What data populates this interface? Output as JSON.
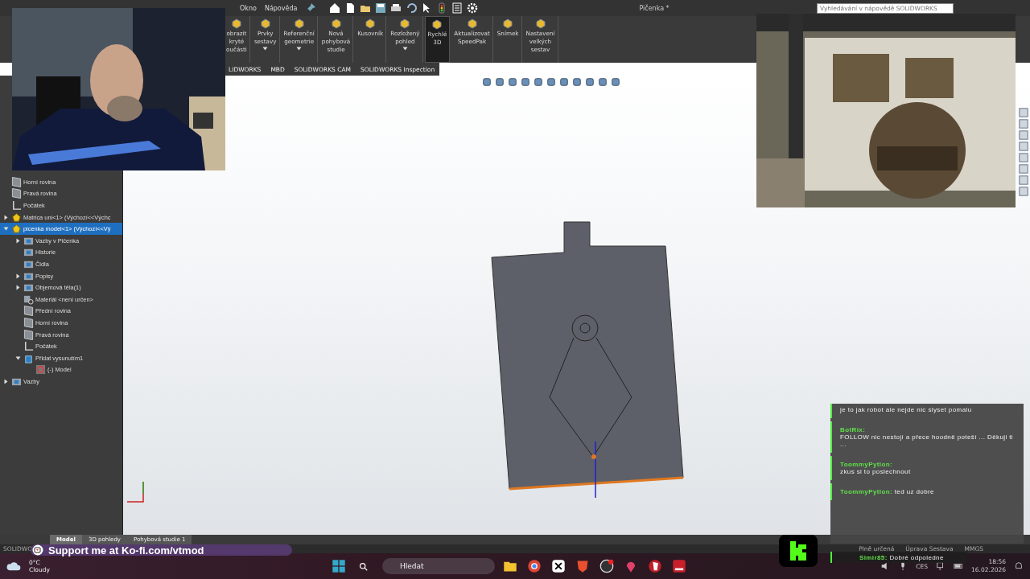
{
  "menu": {
    "items": [
      "Okno",
      "Nápověda"
    ],
    "title": "Pičenka *",
    "search": {
      "placeholder": "Vyhledávání v nápovědě SOLIDWORKS"
    }
  },
  "ribbon": [
    {
      "lines": [
        "obrazit",
        "kryté",
        "oučásti"
      ],
      "dropdown": false,
      "selected": false
    },
    {
      "lines": [
        "Prvky",
        "sestavy"
      ],
      "dropdown": true,
      "selected": false
    },
    {
      "lines": [
        "Referenční",
        "geometrie"
      ],
      "dropdown": true,
      "selected": false
    },
    {
      "lines": [
        "Nová",
        "pohybová",
        "studie"
      ],
      "dropdown": false,
      "selected": false
    },
    {
      "lines": [
        "Kusovník"
      ],
      "dropdown": false,
      "selected": false
    },
    {
      "lines": [
        "Rozložený",
        "pohled"
      ],
      "dropdown": true,
      "selected": false
    },
    {
      "lines": [
        "Rychlé",
        "3D"
      ],
      "dropdown": false,
      "selected": true
    },
    {
      "lines": [
        "Aktualizovat",
        "SpeedPak"
      ],
      "dropdown": false,
      "selected": false
    },
    {
      "lines": [
        "Snímek"
      ],
      "dropdown": false,
      "selected": false
    },
    {
      "lines": [
        "Nastavení",
        "velkých",
        "sestav"
      ],
      "dropdown": false,
      "selected": false
    }
  ],
  "command_tabs": [
    "LIDWORKS",
    "MBD",
    "SOLIDWORKS CAM",
    "SOLIDWORKS Inspection"
  ],
  "tree": [
    {
      "label": "Horní rovina",
      "kind": "plane"
    },
    {
      "label": "Pravá rovina",
      "kind": "plane"
    },
    {
      "label": "Počátek",
      "kind": "origin"
    },
    {
      "label": "Matrica uni<1> (Výchozí<<Výchc",
      "kind": "part",
      "expanded": false,
      "selected": false
    },
    {
      "label": "picenka model<1> (Výchozí<<Vý",
      "kind": "part",
      "expanded": true,
      "selected": true,
      "children": [
        {
          "label": "Vazby v Pičenka",
          "kind": "folder",
          "expanded": false
        },
        {
          "label": "Historie",
          "kind": "folder"
        },
        {
          "label": "Čidla",
          "kind": "folder"
        },
        {
          "label": "Popisy",
          "kind": "folder",
          "expanded": false
        },
        {
          "label": "Objemová těla(1)",
          "kind": "folder",
          "expanded": false
        },
        {
          "label": "Materiál <není určen>",
          "kind": "material"
        },
        {
          "label": "Přední rovina",
          "kind": "plane"
        },
        {
          "label": "Horní rovina",
          "kind": "plane"
        },
        {
          "label": "Pravá rovina",
          "kind": "plane"
        },
        {
          "label": "Počátek",
          "kind": "origin"
        },
        {
          "label": "Přidat vysunutím1",
          "kind": "feature",
          "expanded": true,
          "children": [
            {
              "label": "(-) Model",
              "kind": "sketch"
            }
          ]
        }
      ]
    },
    {
      "label": "Vazby",
      "kind": "folder",
      "expanded": false
    }
  ],
  "bottom_tabs": [
    {
      "label": "Model",
      "selected": true
    },
    {
      "label": "3D pohledy",
      "selected": false
    },
    {
      "label": "Pohybová studie 1",
      "selected": false
    }
  ],
  "status_bar": {
    "left": "SOLIDWO",
    "right": [
      "Plně určená",
      "Úprava Sestava",
      "MMGS"
    ]
  },
  "chat": {
    "cut_line": "je to jak robot ale nejde nic slyset pomalu",
    "messages": [
      {
        "user": "BotRix:",
        "text": "FOLLOW nic nestojí a přece hoodně poteší ... Děkuji ti ...",
        "inline": false
      },
      {
        "user": "ToommyPytlon:",
        "text": "zkus si to poslechnout",
        "inline": false
      },
      {
        "user": "ToommyPytlon:",
        "text": "ted uz dobre",
        "inline": true
      }
    ],
    "last": {
      "user": "Simir85:",
      "text": "Dobré odpoledne"
    }
  },
  "banner": "Support me at Ko-fi.com/vtmod",
  "taskbar": {
    "temperature": "0°C",
    "weather": "Cloudy",
    "search": {
      "placeholder": "Hledat"
    },
    "language": "CES",
    "time": "18:56",
    "date": "16.02.2026"
  }
}
